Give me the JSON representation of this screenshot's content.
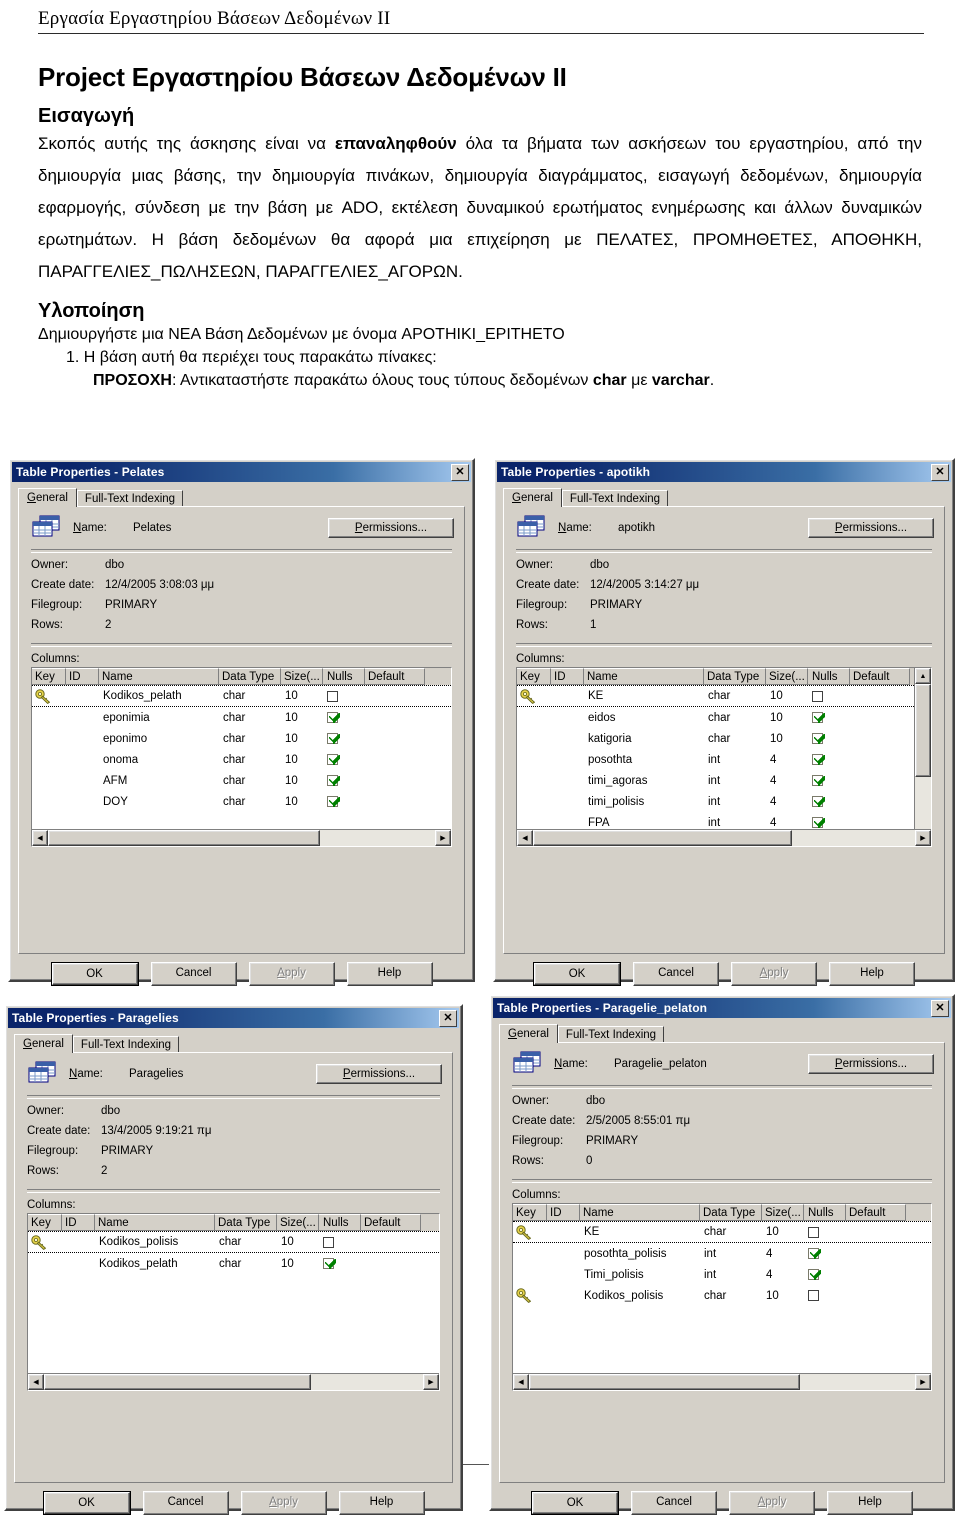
{
  "document": {
    "running_header": "Εργασία Εργαστηρίου Βάσεων Δεδομένων II",
    "title": "Project Εργαστηρίου Βάσεων Δεδομένων II",
    "section_intro_heading": "Εισαγωγή",
    "intro_p1_a": "Σκοπός αυτής της άσκησης είναι να ",
    "intro_p1_bold": "επαναληφθούν",
    "intro_p1_b": " όλα τα βήματα των ασκήσεων του εργαστηρίου, από την δημιουργία μιας βάσης, την δημιουργία πινάκων, δημιουργία διαγράμματος, εισαγωγή δεδομένων, δημιουργία εφαρμογής, σύνδεση με την βάση με ADO, εκτέλεση δυναμικού ερωτήματος ενημέρωσης και άλλων δυναμικών ερωτημάτων. Η βάση δεδομένων θα αφορά μια επιχείρηση με ΠΕΛΑΤΕΣ, ΠΡΟΜΗΘΕΤΕΣ, ΑΠΟΘΗΚΗ, ΠΑΡΑΓΓΕΛΙΕΣ_ΠΩΛΗΣΕΩΝ, ΠΑΡΑΓΓΕΛΙΕΣ_ΑΓΟΡΩΝ.",
    "section_impl_heading": "Υλοποίηση",
    "impl_line1": "Δημιουργήστε μια ΝΕΑ Βάση Δεδομένων με όνομα  APOTHIKI_EPITHETO",
    "impl_item1": "1.   Η βάση αυτή θα περιέχει τους παρακάτω πίνακες:",
    "impl_item1_note_bold": "ΠΡΟΣΟΧΗ",
    "impl_item1_note_rest": ": Αντικαταστήστε παρακάτω όλους τους τύπους δεδομένων ",
    "impl_item1_note_b2": "char",
    "impl_item1_note_mid": " με ",
    "impl_item1_note_b3": "varchar",
    "impl_item1_note_end": "."
  },
  "dialog_common": {
    "tab_general": "General",
    "tab_general_accel": "G",
    "tab_fulltext": "Full-Text Indexing",
    "label_name": "Name:",
    "label_name_accel": "N",
    "button_permissions": "Permissions...",
    "label_owner": "Owner:",
    "label_create_date": "Create date:",
    "label_filegroup": "Filegroup:",
    "label_rows": "Rows:",
    "label_columns": "Columns:",
    "grid_headers": [
      "Key",
      "ID",
      "Name",
      "Data Type",
      "Size(...",
      "Nulls",
      "Default"
    ],
    "button_ok": "OK",
    "button_cancel": "Cancel",
    "button_apply": "Apply",
    "button_help": "Help",
    "close_glyph": "✕",
    "accent_titlebar": "#0a246a",
    "dialog_face": "#d4d0c8",
    "check_color": "#008000",
    "key_color": "#e8d44a"
  },
  "dialogs": [
    {
      "id": "pelates",
      "title": "Table Properties - Pelates",
      "name_value": "Pelates",
      "owner": "dbo",
      "create_date": "12/4/2005 3:08:03 μμ",
      "filegroup": "PRIMARY",
      "rows": "2",
      "has_vscroll": false,
      "columns": [
        {
          "key": true,
          "id": "",
          "name": "Kodikos_pelath",
          "type": "char",
          "size": "10",
          "nulls": false,
          "default": ""
        },
        {
          "key": false,
          "id": "",
          "name": "eponimia",
          "type": "char",
          "size": "10",
          "nulls": true,
          "default": ""
        },
        {
          "key": false,
          "id": "",
          "name": "eponimo",
          "type": "char",
          "size": "10",
          "nulls": true,
          "default": ""
        },
        {
          "key": false,
          "id": "",
          "name": "onoma",
          "type": "char",
          "size": "10",
          "nulls": true,
          "default": ""
        },
        {
          "key": false,
          "id": "",
          "name": "AFM",
          "type": "char",
          "size": "10",
          "nulls": true,
          "default": ""
        },
        {
          "key": false,
          "id": "",
          "name": "DOY",
          "type": "char",
          "size": "10",
          "nulls": true,
          "default": ""
        }
      ]
    },
    {
      "id": "apotikh",
      "title": "Table Properties - apotikh",
      "name_value": "apotikh",
      "owner": "dbo",
      "create_date": "12/4/2005 3:14:27 μμ",
      "filegroup": "PRIMARY",
      "rows": "1",
      "has_vscroll": true,
      "columns": [
        {
          "key": true,
          "id": "",
          "name": "KE",
          "type": "char",
          "size": "10",
          "nulls": false,
          "default": ""
        },
        {
          "key": false,
          "id": "",
          "name": "eidos",
          "type": "char",
          "size": "10",
          "nulls": true,
          "default": ""
        },
        {
          "key": false,
          "id": "",
          "name": "katigoria",
          "type": "char",
          "size": "10",
          "nulls": true,
          "default": ""
        },
        {
          "key": false,
          "id": "",
          "name": "posothta",
          "type": "int",
          "size": "4",
          "nulls": true,
          "default": ""
        },
        {
          "key": false,
          "id": "",
          "name": "timi_agoras",
          "type": "int",
          "size": "4",
          "nulls": true,
          "default": ""
        },
        {
          "key": false,
          "id": "",
          "name": "timi_polisis",
          "type": "int",
          "size": "4",
          "nulls": true,
          "default": ""
        },
        {
          "key": false,
          "id": "",
          "name": "FPA",
          "type": "int",
          "size": "4",
          "nulls": true,
          "default": ""
        }
      ]
    },
    {
      "id": "paragelies",
      "title": "Table Properties - Paragelies",
      "name_value": "Paragelies",
      "owner": "dbo",
      "create_date": "13/4/2005 9:19:21 πμ",
      "filegroup": "PRIMARY",
      "rows": "2",
      "has_vscroll": false,
      "columns": [
        {
          "key": true,
          "id": "",
          "name": "Kodikos_polisis",
          "type": "char",
          "size": "10",
          "nulls": false,
          "default": ""
        },
        {
          "key": false,
          "id": "",
          "name": "Kodikos_pelath",
          "type": "char",
          "size": "10",
          "nulls": true,
          "default": ""
        }
      ]
    },
    {
      "id": "paragelie_pelaton",
      "title": "Table Properties - Paragelie_pelaton",
      "name_value": "Paragelie_pelaton",
      "owner": "dbo",
      "create_date": "2/5/2005 8:55:01 πμ",
      "filegroup": "PRIMARY",
      "rows": "0",
      "has_vscroll": false,
      "columns": [
        {
          "key": true,
          "id": "",
          "name": "KE",
          "type": "char",
          "size": "10",
          "nulls": false,
          "default": ""
        },
        {
          "key": false,
          "id": "",
          "name": "posothta_polisis",
          "type": "int",
          "size": "4",
          "nulls": true,
          "default": ""
        },
        {
          "key": false,
          "id": "",
          "name": "Timi_polisis",
          "type": "int",
          "size": "4",
          "nulls": true,
          "default": ""
        },
        {
          "key": true,
          "id": "",
          "name": "Kodikos_polisis",
          "type": "char",
          "size": "10",
          "nulls": false,
          "default": ""
        }
      ]
    }
  ]
}
